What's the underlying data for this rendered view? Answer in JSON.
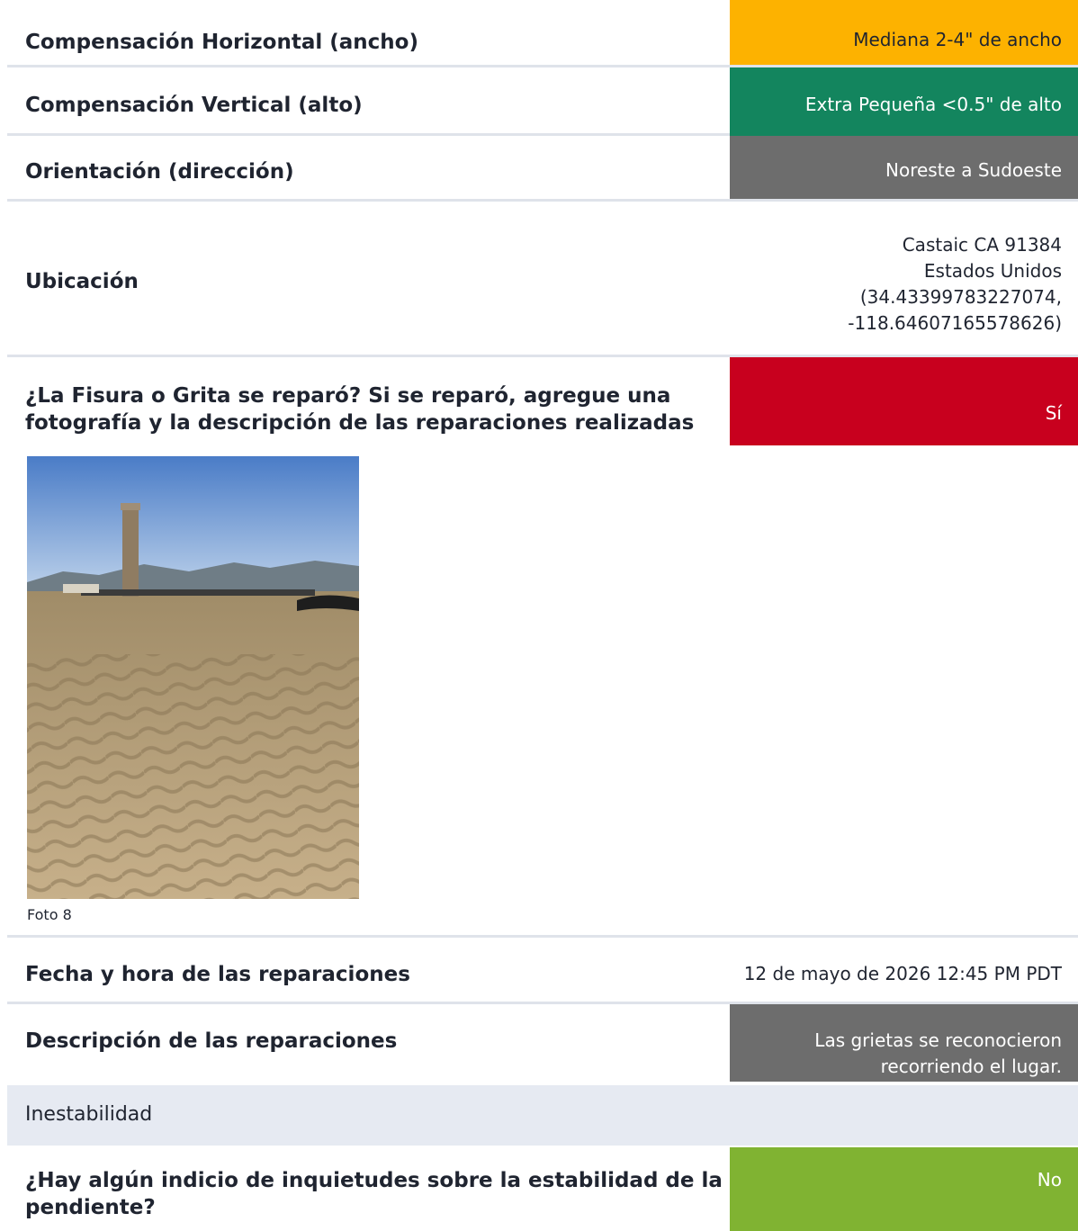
{
  "rows": [
    {
      "label": "Compensación Horizontal (ancho)",
      "value": "Mediana  2-4\" de ancho",
      "color": "#fdb200"
    },
    {
      "label": "Compensación Vertical (alto)",
      "value": "Extra Pequeña <0.5\" de alto",
      "color": "#13855e"
    },
    {
      "label": "Orientación (dirección)",
      "value": "Noreste a Sudoeste",
      "color": "#6d6d6d"
    }
  ],
  "location": {
    "label": "Ubicación",
    "line1": "Castaic CA 91384",
    "line2": "Estados Unidos",
    "line3": "(34.43399783227074,",
    "line4": "-118.64607165578626)"
  },
  "repaired": {
    "label_line1": "¿La Fisura o Grita se reparó? Si se reparó, agregue una",
    "label_line2": "fotografía y la descripción de las reparaciones realizadas",
    "value": "Sí",
    "color": "#c8001e"
  },
  "photo": {
    "caption": "Foto 8"
  },
  "repair_date": {
    "label": "Fecha y hora de las reparaciones",
    "value": "12 de mayo de 2026 12:45 PM PDT"
  },
  "repair_description": {
    "label": "Descripción de las reparaciones",
    "value_line1": "Las grietas se reconocieron",
    "value_line2": "recorriendo el lugar.",
    "color": "#6d6d6d"
  },
  "section": {
    "title": "Inestabilidad"
  },
  "stability": {
    "label_line1": "¿Hay algún indicio de inquietudes sobre la estabilidad de la",
    "label_line2": "pendiente?",
    "value": "No",
    "color": "#80b332"
  }
}
